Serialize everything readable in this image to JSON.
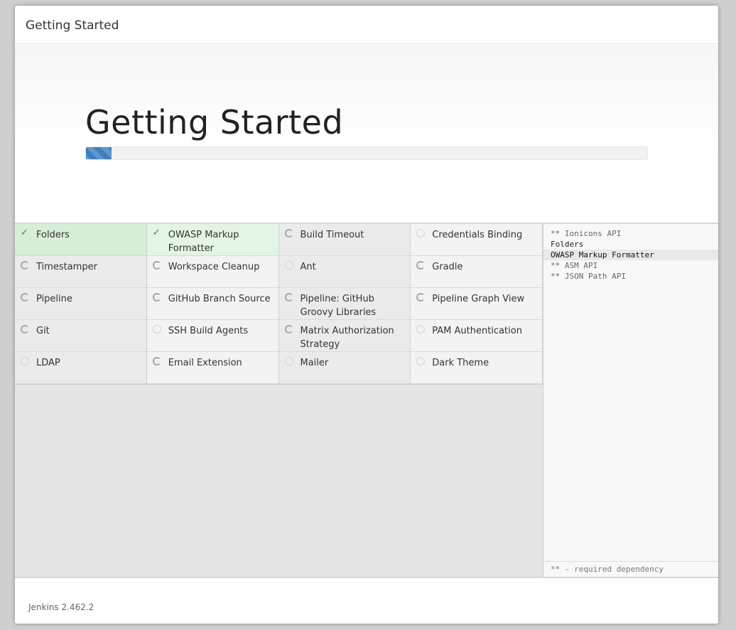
{
  "dialog": {
    "title": "Getting Started"
  },
  "hero": {
    "title": "Getting Started",
    "progress_fraction": 0.046
  },
  "plugins": [
    {
      "name": "Folders",
      "status": "success"
    },
    {
      "name": "OWASP Markup Formatter",
      "status": "success"
    },
    {
      "name": "Build Timeout",
      "status": "loading"
    },
    {
      "name": "Credentials Binding",
      "status": "pending"
    },
    {
      "name": "Timestamper",
      "status": "loading"
    },
    {
      "name": "Workspace Cleanup",
      "status": "loading"
    },
    {
      "name": "Ant",
      "status": "pending"
    },
    {
      "name": "Gradle",
      "status": "loading"
    },
    {
      "name": "Pipeline",
      "status": "loading"
    },
    {
      "name": "GitHub Branch Source",
      "status": "loading"
    },
    {
      "name": "Pipeline: GitHub Groovy Libraries",
      "status": "loading"
    },
    {
      "name": "Pipeline Graph View",
      "status": "loading"
    },
    {
      "name": "Git",
      "status": "loading"
    },
    {
      "name": "SSH Build Agents",
      "status": "pending"
    },
    {
      "name": "Matrix Authorization Strategy",
      "status": "loading"
    },
    {
      "name": "PAM Authentication",
      "status": "pending"
    },
    {
      "name": "LDAP",
      "status": "pending"
    },
    {
      "name": "Email Extension",
      "status": "loading"
    },
    {
      "name": "Mailer",
      "status": "pending"
    },
    {
      "name": "Dark Theme",
      "status": "pending"
    }
  ],
  "log": {
    "lines": [
      {
        "text": "** Ionicons API",
        "kind": "dependency"
      },
      {
        "text": "Folders",
        "kind": "installed"
      },
      {
        "text": "OWASP Markup Formatter",
        "kind": "current"
      },
      {
        "text": "** ASM API",
        "kind": "dependency"
      },
      {
        "text": "** JSON Path API",
        "kind": "dependency"
      }
    ],
    "legend": "** - required dependency"
  },
  "footer": {
    "version": "Jenkins 2.462.2"
  },
  "colors": {
    "success_bg": "#e3f5e3",
    "progress": "#3c7fc1",
    "check": "#3a8a3a"
  },
  "icons": {
    "success": "check-icon",
    "loading": "spinner-icon",
    "pending": "pending-circle-icon"
  }
}
